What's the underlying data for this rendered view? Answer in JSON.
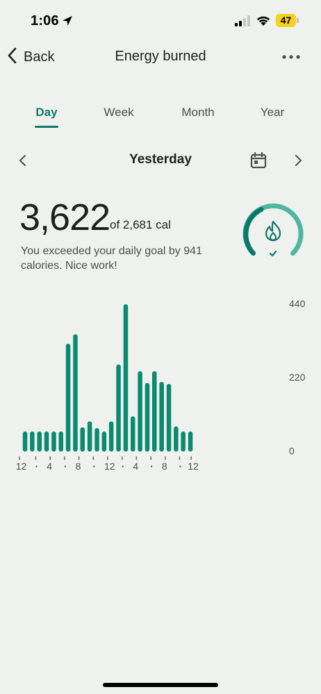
{
  "status_bar": {
    "time": "1:06",
    "battery": "47"
  },
  "header": {
    "back_label": "Back",
    "title": "Energy burned"
  },
  "tabs": [
    {
      "label": "Day",
      "active": true
    },
    {
      "label": "Week",
      "active": false
    },
    {
      "label": "Month",
      "active": false
    },
    {
      "label": "Year",
      "active": false
    }
  ],
  "date_nav": {
    "label": "Yesterday"
  },
  "summary": {
    "value": "3,622",
    "goal_text": "of 2,681 cal",
    "message": "You exceeded your daily goal by 941 calories. Nice work!",
    "goal_progress": 1.0
  },
  "colors": {
    "accent": "#0a7a66",
    "bar": "#0b8a70",
    "ring_light": "#4fb6a2"
  },
  "chart_data": {
    "type": "bar",
    "ylim": [
      0,
      440
    ],
    "y_ticks": [
      "440",
      "220",
      "0"
    ],
    "x_tick_labels": [
      "12",
      "·",
      "4",
      "·",
      "8",
      "·",
      "12",
      "·",
      "4",
      "·",
      "8",
      "·",
      "12"
    ],
    "values": [
      60,
      60,
      60,
      60,
      60,
      60,
      322,
      350,
      72,
      90,
      70,
      60,
      90,
      260,
      440,
      105,
      240,
      205,
      240,
      208,
      202,
      75,
      60,
      60
    ]
  }
}
